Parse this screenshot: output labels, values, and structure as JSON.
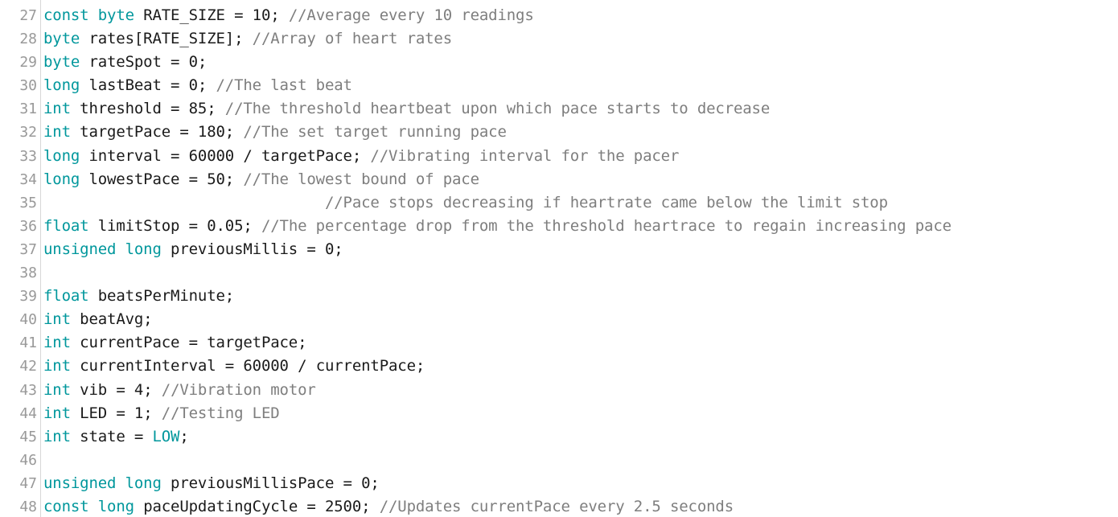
{
  "editor": {
    "name": "code-editor",
    "language": "arduino-c",
    "first_line_number": 27,
    "last_line_number": 48,
    "colors": {
      "background": "#ffffff",
      "keyword": "#00979c",
      "comment": "#7e7e7e",
      "identifier": "#1a1a1a",
      "number": "#1a1a1a",
      "line_number": "#999999",
      "gutter_rule": "#d7d7d7"
    },
    "lines": [
      {
        "number": "27",
        "text": "const byte RATE_SIZE = 10; //Average every 10 readings",
        "tokens": [
          {
            "t": "const",
            "c": "kw"
          },
          {
            "t": " ",
            "c": "pl"
          },
          {
            "t": "byte",
            "c": "kw"
          },
          {
            "t": " RATE_SIZE = ",
            "c": "id"
          },
          {
            "t": "10",
            "c": "num"
          },
          {
            "t": "; ",
            "c": "op"
          },
          {
            "t": "//Average every 10 readings",
            "c": "cm"
          }
        ]
      },
      {
        "number": "28",
        "text": "byte rates[RATE_SIZE]; //Array of heart rates",
        "tokens": [
          {
            "t": "byte",
            "c": "kw"
          },
          {
            "t": " rates[RATE_SIZE]; ",
            "c": "id"
          },
          {
            "t": "//Array of heart rates",
            "c": "cm"
          }
        ]
      },
      {
        "number": "29",
        "text": "byte rateSpot = 0;",
        "tokens": [
          {
            "t": "byte",
            "c": "kw"
          },
          {
            "t": " rateSpot = ",
            "c": "id"
          },
          {
            "t": "0",
            "c": "num"
          },
          {
            "t": ";",
            "c": "op"
          }
        ]
      },
      {
        "number": "30",
        "text": "long lastBeat = 0; //The last beat",
        "tokens": [
          {
            "t": "long",
            "c": "kw"
          },
          {
            "t": " lastBeat = ",
            "c": "id"
          },
          {
            "t": "0",
            "c": "num"
          },
          {
            "t": "; ",
            "c": "op"
          },
          {
            "t": "//The last beat",
            "c": "cm"
          }
        ]
      },
      {
        "number": "31",
        "text": "int threshold = 85; //The threshold heartbeat upon which pace starts to decrease",
        "tokens": [
          {
            "t": "int",
            "c": "kw"
          },
          {
            "t": " threshold = ",
            "c": "id"
          },
          {
            "t": "85",
            "c": "num"
          },
          {
            "t": "; ",
            "c": "op"
          },
          {
            "t": "//The threshold heartbeat upon which pace starts to decrease",
            "c": "cm"
          }
        ]
      },
      {
        "number": "32",
        "text": "int targetPace = 180; //The set target running pace",
        "tokens": [
          {
            "t": "int",
            "c": "kw"
          },
          {
            "t": " targetPace = ",
            "c": "id"
          },
          {
            "t": "180",
            "c": "num"
          },
          {
            "t": "; ",
            "c": "op"
          },
          {
            "t": "//The set target running pace",
            "c": "cm"
          }
        ]
      },
      {
        "number": "33",
        "text": "long interval = 60000 / targetPace; //Vibrating interval for the pacer",
        "tokens": [
          {
            "t": "long",
            "c": "kw"
          },
          {
            "t": " interval = ",
            "c": "id"
          },
          {
            "t": "60000",
            "c": "num"
          },
          {
            "t": " / targetPace; ",
            "c": "id"
          },
          {
            "t": "//Vibrating interval for the pacer",
            "c": "cm"
          }
        ]
      },
      {
        "number": "34",
        "text": "long lowestPace = 50; //The lowest bound of pace",
        "tokens": [
          {
            "t": "long",
            "c": "kw"
          },
          {
            "t": " lowestPace = ",
            "c": "id"
          },
          {
            "t": "50",
            "c": "num"
          },
          {
            "t": "; ",
            "c": "op"
          },
          {
            "t": "//The lowest bound of pace",
            "c": "cm"
          }
        ]
      },
      {
        "number": "35",
        "text": "                               //Pace stops decreasing if heartrate came below the limit stop",
        "tokens": [
          {
            "t": "                               ",
            "c": "pl"
          },
          {
            "t": "//Pace stops decreasing if heartrate came below the limit stop",
            "c": "cm"
          }
        ]
      },
      {
        "number": "36",
        "text": "float limitStop = 0.05; //The percentage drop from the threshold heartrace to regain increasing pace",
        "tokens": [
          {
            "t": "float",
            "c": "kw"
          },
          {
            "t": " limitStop = ",
            "c": "id"
          },
          {
            "t": "0.05",
            "c": "num"
          },
          {
            "t": "; ",
            "c": "op"
          },
          {
            "t": "//The percentage drop from the threshold heartrace to regain increasing pace",
            "c": "cm"
          }
        ]
      },
      {
        "number": "37",
        "text": "unsigned long previousMillis = 0;",
        "tokens": [
          {
            "t": "unsigned",
            "c": "kw"
          },
          {
            "t": " ",
            "c": "pl"
          },
          {
            "t": "long",
            "c": "kw"
          },
          {
            "t": " previousMillis = ",
            "c": "id"
          },
          {
            "t": "0",
            "c": "num"
          },
          {
            "t": ";",
            "c": "op"
          }
        ]
      },
      {
        "number": "38",
        "text": "",
        "tokens": []
      },
      {
        "number": "39",
        "text": "float beatsPerMinute;",
        "tokens": [
          {
            "t": "float",
            "c": "kw"
          },
          {
            "t": " beatsPerMinute;",
            "c": "id"
          }
        ]
      },
      {
        "number": "40",
        "text": "int beatAvg;",
        "tokens": [
          {
            "t": "int",
            "c": "kw"
          },
          {
            "t": " beatAvg;",
            "c": "id"
          }
        ]
      },
      {
        "number": "41",
        "text": "int currentPace = targetPace;",
        "tokens": [
          {
            "t": "int",
            "c": "kw"
          },
          {
            "t": " currentPace = targetPace;",
            "c": "id"
          }
        ]
      },
      {
        "number": "42",
        "text": "int currentInterval = 60000 / currentPace;",
        "tokens": [
          {
            "t": "int",
            "c": "kw"
          },
          {
            "t": " currentInterval = ",
            "c": "id"
          },
          {
            "t": "60000",
            "c": "num"
          },
          {
            "t": " / currentPace;",
            "c": "id"
          }
        ]
      },
      {
        "number": "43",
        "text": "int vib = 4; //Vibration motor",
        "tokens": [
          {
            "t": "int",
            "c": "kw"
          },
          {
            "t": " vib = ",
            "c": "id"
          },
          {
            "t": "4",
            "c": "num"
          },
          {
            "t": "; ",
            "c": "op"
          },
          {
            "t": "//Vibration motor",
            "c": "cm"
          }
        ]
      },
      {
        "number": "44",
        "text": "int LED = 1; //Testing LED",
        "tokens": [
          {
            "t": "int",
            "c": "kw"
          },
          {
            "t": " LED = ",
            "c": "id"
          },
          {
            "t": "1",
            "c": "num"
          },
          {
            "t": "; ",
            "c": "op"
          },
          {
            "t": "//Testing LED",
            "c": "cm"
          }
        ]
      },
      {
        "number": "45",
        "text": "int state = LOW;",
        "tokens": [
          {
            "t": "int",
            "c": "kw"
          },
          {
            "t": " state = ",
            "c": "id"
          },
          {
            "t": "LOW",
            "c": "lit"
          },
          {
            "t": ";",
            "c": "op"
          }
        ]
      },
      {
        "number": "46",
        "text": "",
        "tokens": []
      },
      {
        "number": "47",
        "text": "unsigned long previousMillisPace = 0;",
        "tokens": [
          {
            "t": "unsigned",
            "c": "kw"
          },
          {
            "t": " ",
            "c": "pl"
          },
          {
            "t": "long",
            "c": "kw"
          },
          {
            "t": " previousMillisPace = ",
            "c": "id"
          },
          {
            "t": "0",
            "c": "num"
          },
          {
            "t": ";",
            "c": "op"
          }
        ]
      },
      {
        "number": "48",
        "text": "const long paceUpdatingCycle = 2500; //Updates currentPace every 2.5 seconds",
        "tokens": [
          {
            "t": "const",
            "c": "kw"
          },
          {
            "t": " ",
            "c": "pl"
          },
          {
            "t": "long",
            "c": "kw"
          },
          {
            "t": " paceUpdatingCycle = ",
            "c": "id"
          },
          {
            "t": "2500",
            "c": "num"
          },
          {
            "t": "; ",
            "c": "op"
          },
          {
            "t": "//Updates currentPace every 2.5 seconds",
            "c": "cm"
          }
        ]
      }
    ]
  }
}
